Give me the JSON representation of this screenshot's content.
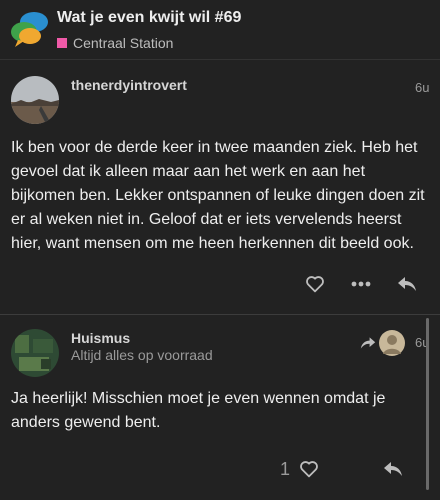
{
  "header": {
    "title": "Wat je even kwijt wil #69",
    "category": "Centraal Station",
    "category_color": "#f05aa8"
  },
  "posts": [
    {
      "username": "thenerdyintrovert",
      "age": "6u",
      "text": "Ik ben voor de derde keer in twee maanden ziek. Heb het gevoel dat ik alleen maar aan het werk en aan het bijkomen ben. Lekker ontspannen of leuke dingen doen zit er al weken niet in. Geloof dat er iets vervelends heerst hier, want mensen om me heen herkennen dit beeld ook.",
      "actions": [
        "heart-icon",
        "more-icon",
        "reply-icon"
      ]
    },
    {
      "username": "Huismus",
      "title": "Altijd alles op voorraad",
      "age": "6u",
      "text": "Ja heerlijk! Misschien moet je even wennen omdat je anders gewend bent.",
      "like_count": "1",
      "actions": [
        "heart-icon",
        "reply-icon"
      ]
    }
  ],
  "colors": {
    "background": "#222222",
    "accent": "#f05aa8"
  }
}
